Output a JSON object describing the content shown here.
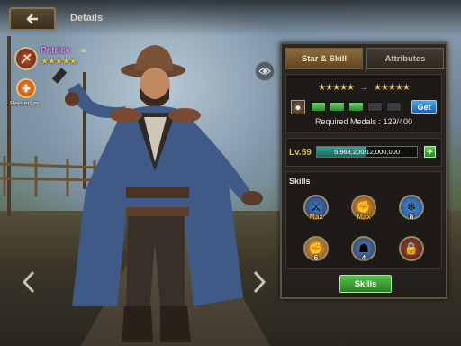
{
  "header": {
    "title": "Details"
  },
  "hero": {
    "name": "Patrick",
    "stars": "★★★★★",
    "class_label": "Berserker"
  },
  "panel": {
    "tabs": [
      {
        "label": "Star & Skill"
      },
      {
        "label": "Attributes"
      }
    ],
    "star_current": "★★★★★",
    "star_next": "★★★★★",
    "arrow": "→",
    "medal_segments_filled": 3,
    "medal_segments_total": 5,
    "get_label": "Get",
    "required_medals": "Required Medals : 129/400",
    "level_label": "Lv.59",
    "xp_current": 5968200,
    "xp_max": 12000000,
    "xp_text": "5,968,200/12,000,000",
    "skills_heading": "Skills",
    "skills": [
      {
        "label": "Max",
        "label_type": "max"
      },
      {
        "label": "Max",
        "label_type": "max"
      },
      {
        "label": "8",
        "label_type": "num"
      },
      {
        "label": "6",
        "label_type": "num"
      },
      {
        "label": "4",
        "label_type": "num"
      },
      {
        "label": "",
        "label_type": "locked"
      }
    ],
    "skills_button": "Skills"
  },
  "colors": {
    "accent": "#e7b740",
    "hero_name": "#d88cf0",
    "button_green": "#2b7d22",
    "get_blue": "#1d5fae"
  }
}
